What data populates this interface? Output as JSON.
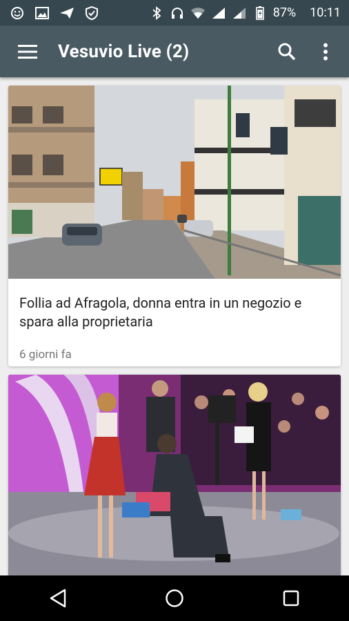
{
  "status_bar": {
    "battery": "87%",
    "time": "10:11",
    "left_icons": [
      "emoji-icon",
      "image-icon",
      "send-icon",
      "shield-icon"
    ],
    "right_icons": [
      "bluetooth-icon",
      "headphones-icon",
      "wifi-icon",
      "signal-icon",
      "signal-icon",
      "battery-icon"
    ]
  },
  "app_bar": {
    "title": "Vesuvio Live (2)",
    "icons": [
      "menu-icon",
      "search-icon",
      "more-vert-icon"
    ]
  },
  "articles": [
    {
      "title": "Follia ad Afragola, donna entra in un negozio e spara alla proprietaria",
      "time": "6 giorni fa",
      "image": "street-scene"
    },
    {
      "title": "",
      "time": "",
      "image": "tv-studio-proposal"
    }
  ],
  "nav_bar": {
    "icons": [
      "back-icon",
      "home-icon",
      "recents-icon"
    ]
  },
  "colors": {
    "status_bar": "#37474f",
    "app_bar": "#4a5a62",
    "background": "#eeeeee"
  }
}
